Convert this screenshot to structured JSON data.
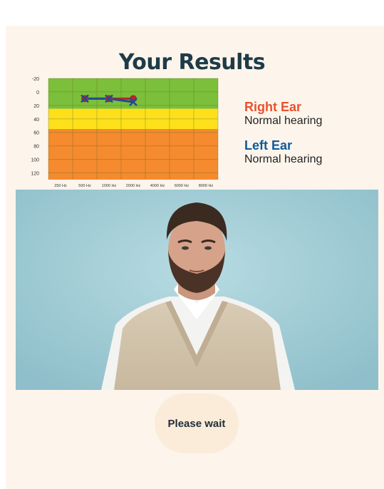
{
  "page": {
    "title": "Your Results"
  },
  "chart_data": {
    "type": "line",
    "x_categories": [
      "250 Hz",
      "500 Hz",
      "1000 Hz",
      "2000 Hz",
      "4000 Hz",
      "6000 Hz",
      "8000 Hz"
    ],
    "y_ticks": [
      -20,
      0,
      20,
      40,
      60,
      80,
      100,
      120
    ],
    "ylim": [
      -20,
      130
    ],
    "y_inverted": true,
    "bands": [
      {
        "from": -20,
        "to": 25,
        "color": "#7cbf3a"
      },
      {
        "from": 25,
        "to": 55,
        "color": "#fde01a"
      },
      {
        "from": 55,
        "to": 130,
        "color": "#f58a2e"
      }
    ],
    "series": [
      {
        "ear": "right",
        "marker": "circle",
        "color": "#b3262f",
        "x": [
          "500 Hz",
          "1000 Hz",
          "2000 Hz"
        ],
        "values": [
          10,
          10,
          10
        ]
      },
      {
        "ear": "left",
        "marker": "x",
        "color": "#1d4e8f",
        "x": [
          "500 Hz",
          "1000 Hz",
          "2000 Hz"
        ],
        "values": [
          10,
          10,
          15
        ]
      }
    ]
  },
  "results": {
    "right": {
      "title": "Right Ear",
      "status": "Normal hearing"
    },
    "left": {
      "title": "Left Ear",
      "status": "Normal hearing"
    }
  },
  "button": {
    "label": "Please wait"
  }
}
